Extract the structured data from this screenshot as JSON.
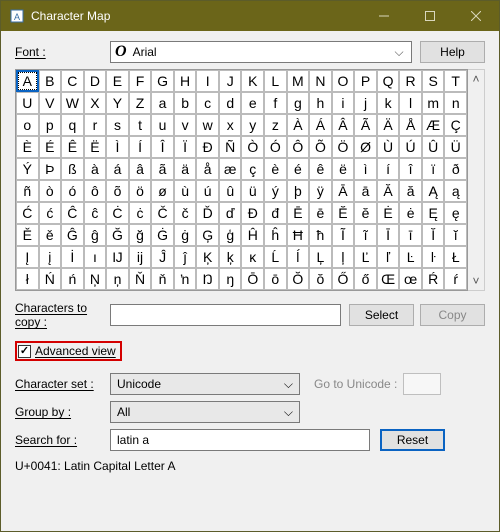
{
  "window": {
    "title": "Character Map"
  },
  "labels": {
    "font": "Font :",
    "help": "Help",
    "chars_to_copy": "Characters to copy :",
    "select": "Select",
    "copy": "Copy",
    "advanced_view": "Advanced view",
    "character_set": "Character set :",
    "go_to_unicode": "Go to Unicode :",
    "group_by": "Group by :",
    "search_for": "Search for :",
    "reset": "Reset"
  },
  "font": {
    "name": "Arial",
    "sample": "O"
  },
  "values": {
    "chars_to_copy": "",
    "character_set": "Unicode",
    "group_by": "All",
    "search_for": "latin a",
    "go_to_unicode": ""
  },
  "status": "U+0041: Latin Capital Letter A",
  "grid": [
    "A",
    "B",
    "C",
    "D",
    "E",
    "F",
    "G",
    "H",
    "I",
    "J",
    "K",
    "L",
    "M",
    "N",
    "O",
    "P",
    "Q",
    "R",
    "S",
    "T",
    "U",
    "V",
    "W",
    "X",
    "Y",
    "Z",
    "a",
    "b",
    "c",
    "d",
    "e",
    "f",
    "g",
    "h",
    "i",
    "j",
    "k",
    "l",
    "m",
    "n",
    "o",
    "p",
    "q",
    "r",
    "s",
    "t",
    "u",
    "v",
    "w",
    "x",
    "y",
    "z",
    "À",
    "Á",
    "Â",
    "Ã",
    "Ä",
    "Å",
    "Æ",
    "Ç",
    "È",
    "É",
    "Ê",
    "Ë",
    "Ì",
    "Í",
    "Î",
    "Ï",
    "Ð",
    "Ñ",
    "Ò",
    "Ó",
    "Ô",
    "Õ",
    "Ö",
    "Ø",
    "Ù",
    "Ú",
    "Û",
    "Ü",
    "Ý",
    "Þ",
    "ß",
    "à",
    "á",
    "â",
    "ã",
    "ä",
    "å",
    "æ",
    "ç",
    "è",
    "é",
    "ê",
    "ë",
    "ì",
    "í",
    "î",
    "ï",
    "ð",
    "ñ",
    "ò",
    "ó",
    "ô",
    "õ",
    "ö",
    "ø",
    "ù",
    "ú",
    "û",
    "ü",
    "ý",
    "þ",
    "ÿ",
    "Ā",
    "ā",
    "Ă",
    "ă",
    "Ą",
    "ą",
    "Ć",
    "ć",
    "Ĉ",
    "ĉ",
    "Ċ",
    "ċ",
    "Č",
    "č",
    "Ď",
    "ď",
    "Đ",
    "đ",
    "Ē",
    "ē",
    "Ĕ",
    "ĕ",
    "Ė",
    "ė",
    "Ę",
    "ę",
    "Ě",
    "ě",
    "Ĝ",
    "ĝ",
    "Ğ",
    "ğ",
    "Ġ",
    "ġ",
    "Ģ",
    "ģ",
    "Ĥ",
    "ĥ",
    "Ħ",
    "ħ",
    "Ĩ",
    "ĩ",
    "Ī",
    "ī",
    "Ĭ",
    "ĭ",
    "Į",
    "į",
    "İ",
    "ı",
    "Ĳ",
    "ĳ",
    "Ĵ",
    "ĵ",
    "Ķ",
    "ķ",
    "ĸ",
    "Ĺ",
    "ĺ",
    "Ļ",
    "ļ",
    "Ľ",
    "ľ",
    "Ŀ",
    "ŀ",
    "Ł",
    "ł",
    "Ń",
    "ń",
    "Ņ",
    "ņ",
    "Ň",
    "ň",
    "ŉ",
    "Ŋ",
    "ŋ",
    "Ō",
    "ō",
    "Ŏ",
    "ŏ",
    "Ő",
    "ő",
    "Œ",
    "œ",
    "Ŕ",
    "ŕ"
  ],
  "selected_index": 0
}
